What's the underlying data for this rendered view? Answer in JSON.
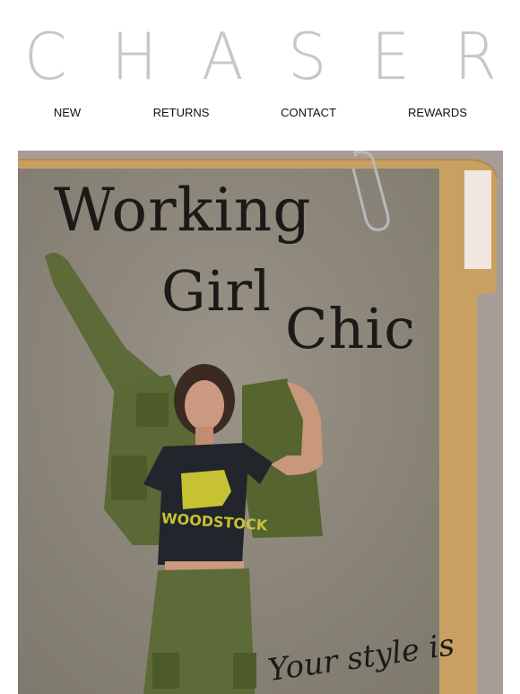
{
  "brand": {
    "logo_text": "CHASER"
  },
  "nav": {
    "items": [
      {
        "label": "NEW"
      },
      {
        "label": "RETURNS"
      },
      {
        "label": "CONTACT"
      },
      {
        "label": "REWARDS"
      }
    ]
  },
  "hero": {
    "headline_line1": "Working",
    "headline_line2": "Girl",
    "headline_line3": "Chic",
    "tshirt_print": "WOODSTOCK",
    "tagline": "Your style is"
  },
  "colors": {
    "logo": "#c7c7c7",
    "folder": "#c9a062",
    "wall": "#8f897d",
    "jacket": "#5c6b37",
    "tshirt": "#22252b",
    "print": "#c7c233"
  }
}
